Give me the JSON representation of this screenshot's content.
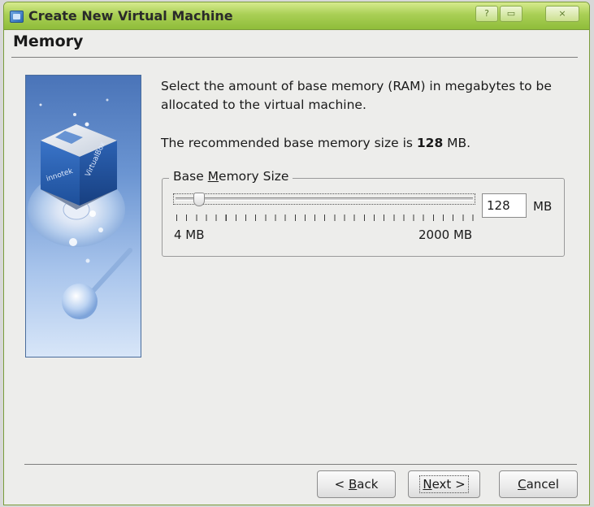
{
  "window": {
    "title": "Create New Virtual Machine",
    "controls": {
      "help": "?",
      "maximize": "▭",
      "close": "×"
    }
  },
  "page": {
    "heading": "Memory",
    "description": "Select the amount of base memory (RAM) in megabytes to be allocated to the virtual machine.",
    "recommend_prefix": "The recommended base memory size is ",
    "recommend_value": "128",
    "recommend_suffix": " MB."
  },
  "memory": {
    "group_label_before": "Base ",
    "group_label_mnemonic": "M",
    "group_label_after": "emory Size",
    "value": "128",
    "unit": "MB",
    "slider_min_label": "4 MB",
    "slider_max_label": "2000 MB",
    "slider_fraction": 0.062
  },
  "buttons": {
    "back_prefix": "< ",
    "back_mnemonic": "B",
    "back_rest": "ack",
    "next_mnemonic": "N",
    "next_rest": "ext >",
    "cancel_mnemonic": "C",
    "cancel_rest": "ancel"
  },
  "colors": {
    "titlebar_accent": "#a9cf55",
    "panel_bg": "#ededeb"
  },
  "icons": {
    "app": "virtualbox-icon",
    "side": "virtualbox-wizard-image"
  }
}
